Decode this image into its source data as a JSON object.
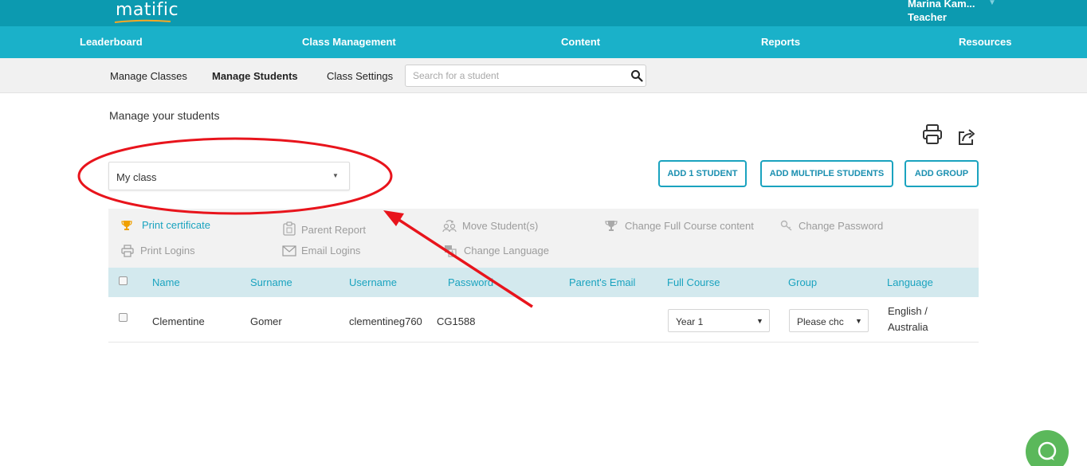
{
  "app": {
    "logo": "matific",
    "user": {
      "name": "Marina Kam...",
      "role": "Teacher"
    }
  },
  "mainnav": {
    "items": [
      {
        "label": "Leaderboard"
      },
      {
        "label": "Class Management"
      },
      {
        "label": "Content"
      },
      {
        "label": "Reports"
      },
      {
        "label": "Resources"
      }
    ]
  },
  "subnav": {
    "items": [
      {
        "label": "Manage Classes"
      },
      {
        "label": "Manage Students",
        "active": true
      },
      {
        "label": "Class Settings"
      }
    ],
    "search": {
      "placeholder": "Search for a student",
      "value": ""
    }
  },
  "page": {
    "heading": "Manage your students",
    "class_select": {
      "value": "My class"
    },
    "buttons": {
      "add_one": "ADD 1 STUDENT",
      "add_multiple": "ADD MULTIPLE STUDENTS",
      "add_group": "ADD GROUP"
    }
  },
  "toolbar": {
    "print_certificate": "Print certificate",
    "parent_report": "Parent Report",
    "move_students": "Move Student(s)",
    "change_full_course": "Change Full Course content",
    "change_password": "Change Password",
    "print_logins": "Print Logins",
    "email_logins": "Email Logins",
    "change_language": "Change Language"
  },
  "table": {
    "columns": [
      "Name",
      "Surname",
      "Username",
      "Password",
      "Parent's Email",
      "Full Course",
      "Group",
      "Language"
    ],
    "rows": [
      {
        "name": "Clementine",
        "surname": "Gomer",
        "username": "clementineg760",
        "password": "CG1588",
        "parent_email": "",
        "full_course": "Year 1",
        "group": "Please chc",
        "language_line1": "English /",
        "language_line2": "Australia"
      }
    ]
  },
  "colors": {
    "topbar": "#0c9ab0",
    "nav": "#1ab1c9",
    "accent": "#1aa3bf",
    "annotation": "#e8141c",
    "help": "#5bb85b"
  },
  "icons": {
    "search": "search-icon",
    "print": "printer-icon",
    "share": "share-icon",
    "trophy": "trophy-icon",
    "help": "chat-icon"
  }
}
